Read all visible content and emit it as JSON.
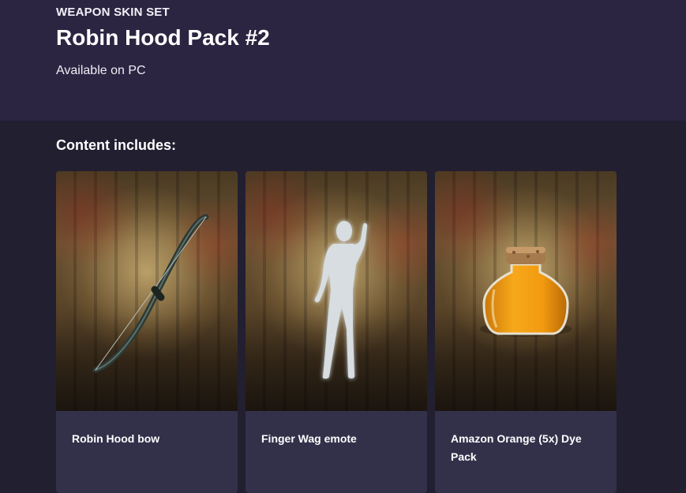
{
  "header": {
    "eyebrow": "WEAPON SKIN SET",
    "title": "Robin Hood Pack #2",
    "availability": "Available on PC"
  },
  "content": {
    "heading": "Content includes:",
    "items": [
      {
        "label": "Robin Hood bow",
        "icon": "bow-icon"
      },
      {
        "label": "Finger Wag emote",
        "icon": "emote-silhouette-icon"
      },
      {
        "label": "Amazon Orange (5x) Dye Pack",
        "icon": "dye-jar-icon"
      }
    ]
  },
  "colors": {
    "hero_bg": "#2b2541",
    "page_bg": "#221f31",
    "card_bg": "#33304a",
    "dye_orange": "#f0a010"
  }
}
